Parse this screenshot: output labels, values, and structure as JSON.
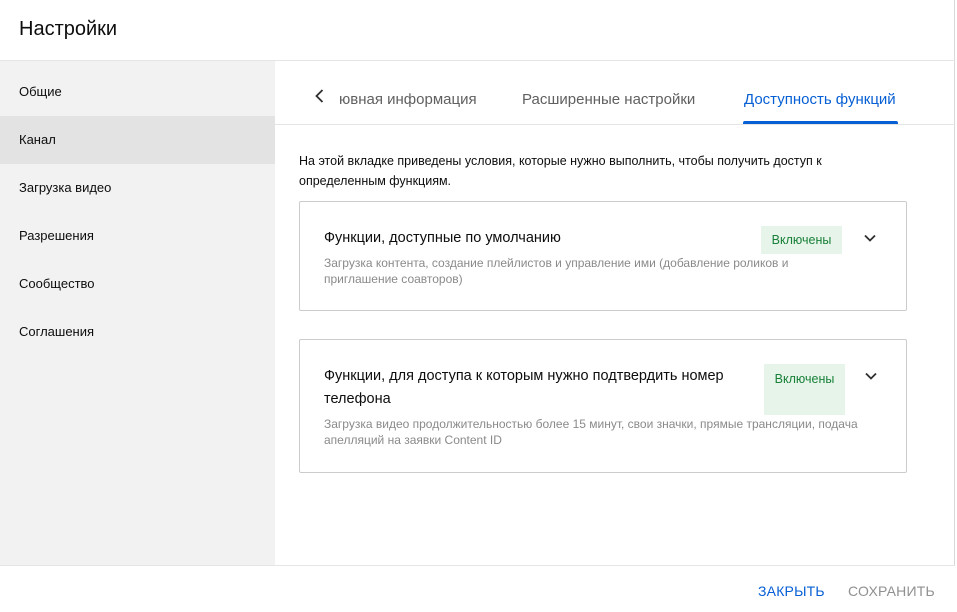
{
  "dialog": {
    "title": "Настройки"
  },
  "sidebar": {
    "items": [
      {
        "label": "Общие"
      },
      {
        "label": "Канал"
      },
      {
        "label": "Загрузка видео"
      },
      {
        "label": "Разрешения"
      },
      {
        "label": "Сообщество"
      },
      {
        "label": "Соглашения"
      }
    ],
    "active_index": 1
  },
  "tabs": {
    "items": [
      {
        "label": "ювная информация"
      },
      {
        "label": "Расширенные настройки"
      },
      {
        "label": "Доступность функций"
      }
    ],
    "active_index": 2
  },
  "main": {
    "intro": "На этой вкладке приведены условия, которые нужно выполнить, чтобы получить доступ к определенным функциям.",
    "cards": [
      {
        "title": "Функции, доступные по умолчанию",
        "description": "Загрузка контента, создание плейлистов и управление ими (добавление роликов и приглашение соавторов)",
        "status": "Включены"
      },
      {
        "title": "Функции, для доступа к которым нужно подтвердить номер телефона",
        "description": "Загрузка видео продолжительностью более 15 минут, свои значки, прямые трансляции, подача апелляций на заявки Content ID",
        "status": "Включены"
      }
    ]
  },
  "footer": {
    "close_label": "ЗАКРЫТЬ",
    "save_label": "СОХРАНИТЬ"
  },
  "colors": {
    "accent": "#065fd4",
    "status_text": "#188038",
    "status_bg": "#e6f4ea",
    "sidebar_bg": "#f2f2f2",
    "sidebar_active_bg": "#e3e3e3"
  },
  "icons": {
    "tab_back": "chevron-left-icon",
    "card_expand": "chevron-down-icon"
  }
}
